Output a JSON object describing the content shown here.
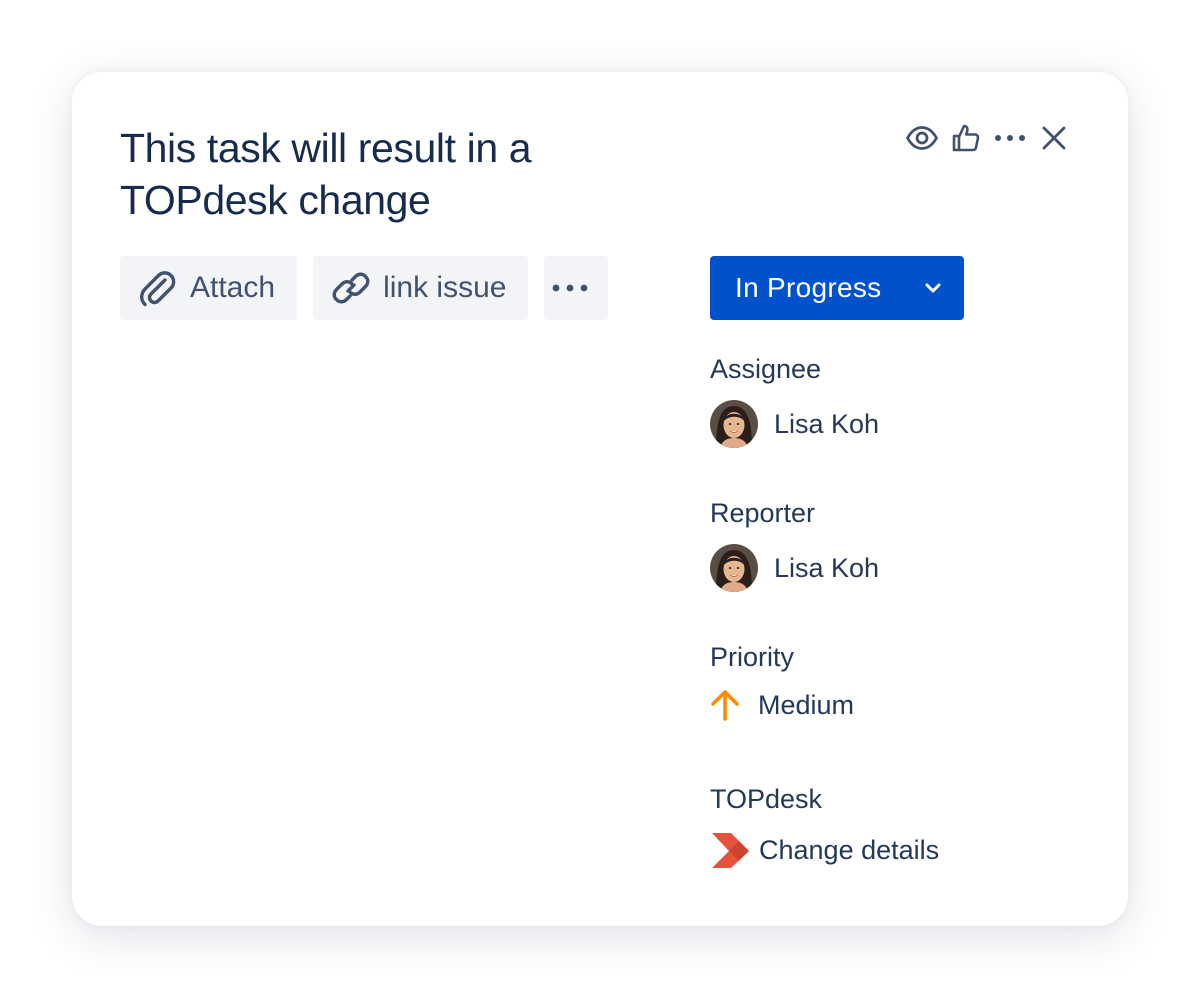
{
  "issue": {
    "title_line1": "This task will result in a",
    "title_line2": "TOPdesk change"
  },
  "header_actions": {
    "icons": [
      "eye-icon",
      "thumbs-up-icon",
      "more-horizontal-icon",
      "close-icon"
    ]
  },
  "toolbar": {
    "attach_label": "Attach",
    "link_label": "link issue",
    "more_icon": "more-horizontal-icon"
  },
  "status": {
    "label": "In Progress",
    "color": "#0052CC"
  },
  "fields": {
    "assignee": {
      "label": "Assignee",
      "name": "Lisa Koh"
    },
    "reporter": {
      "label": "Reporter",
      "name": "Lisa Koh"
    },
    "priority": {
      "label": "Priority",
      "value": "Medium",
      "icon_color": "#FF8B00"
    },
    "topdesk": {
      "label": "TOPdesk",
      "value": "Change details",
      "icon_color": "#E5533D"
    }
  }
}
